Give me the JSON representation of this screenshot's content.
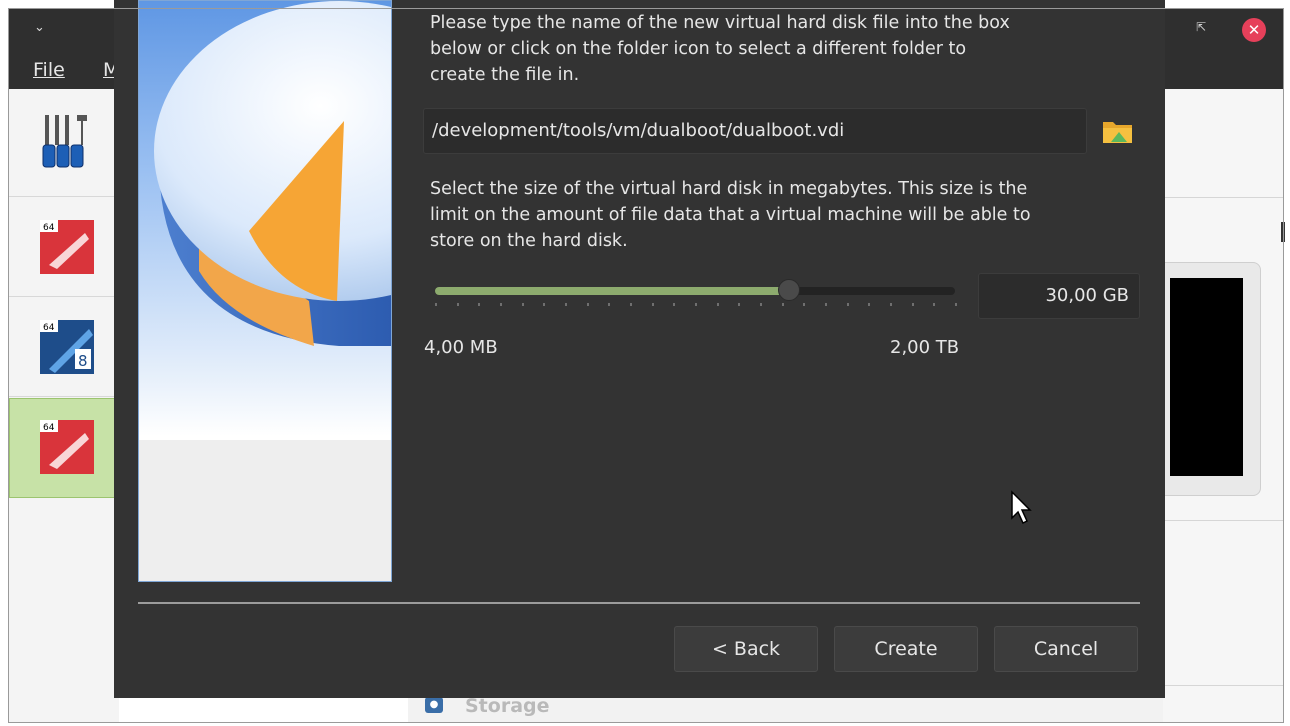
{
  "background_window": {
    "menu": {
      "file": "File",
      "partial_next": "M"
    },
    "bottom_section_label": "Storage"
  },
  "dialog": {
    "description_top": [
      "Please type the name of the new virtual hard disk file into the box",
      "below or click on the folder icon to select a different folder to",
      "create the file in."
    ],
    "file_path": "/development/tools/vm/dualboot/dualboot.vdi",
    "description_size": [
      "Select the size of the virtual hard disk in megabytes. This size is the",
      "limit on the amount of file data that a virtual machine will be able to",
      "store on the hard disk."
    ],
    "size_value": "30,00 GB",
    "slider_fraction": 0.68,
    "range_min": "4,00 MB",
    "range_max": "2,00 TB",
    "buttons": {
      "back": "< Back",
      "create": "Create",
      "cancel": "Cancel"
    }
  },
  "icons": [
    "chevron-down-icon",
    "restore-window-icon",
    "close-icon",
    "tools-icon",
    "vm-icon",
    "folder-icon",
    "storage-icon",
    "mouse-pointer-icon"
  ],
  "colors": {
    "dialog_bg": "#333333",
    "slider_fill": "#8dab6e",
    "close_red": "#e6405a",
    "selected_row": "#c7e2a7"
  }
}
